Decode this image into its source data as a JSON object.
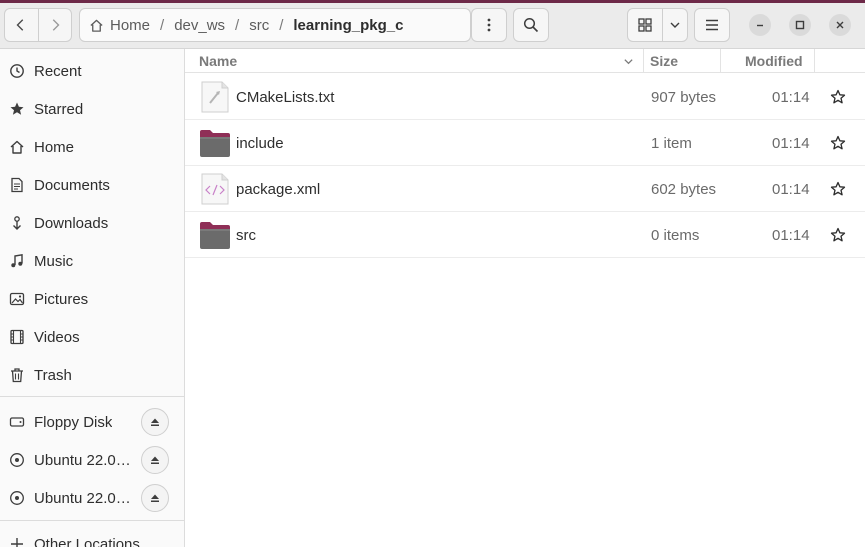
{
  "window": {
    "accent_color": "#6d2948"
  },
  "toolbar": {
    "back_icon": "chevron-left-icon",
    "forward_icon": "chevron-right-icon",
    "breadcrumb": {
      "home_icon": "home-icon",
      "segments": [
        "Home",
        "dev_ws",
        "src",
        "learning_pkg_c"
      ],
      "separator": "/"
    },
    "path_menu_icon": "vertical-dots-icon",
    "search_icon": "search-icon",
    "view_icon": "grid-view-icon",
    "view_options_icon": "chevron-down-icon",
    "main_menu_icon": "hamburger-icon",
    "window_controls": [
      "minimize-icon",
      "maximize-icon",
      "close-icon"
    ]
  },
  "sidebar": {
    "places": [
      {
        "label": "Recent",
        "icon": "clock-icon"
      },
      {
        "label": "Starred",
        "icon": "star-icon"
      },
      {
        "label": "Home",
        "icon": "home-icon"
      },
      {
        "label": "Documents",
        "icon": "document-icon"
      },
      {
        "label": "Downloads",
        "icon": "download-icon"
      },
      {
        "label": "Music",
        "icon": "music-icon"
      },
      {
        "label": "Pictures",
        "icon": "picture-icon"
      },
      {
        "label": "Videos",
        "icon": "video-icon"
      },
      {
        "label": "Trash",
        "icon": "trash-icon"
      }
    ],
    "devices": [
      {
        "label": "Floppy Disk",
        "icon": "drive-icon"
      },
      {
        "label": "Ubuntu 22.0…",
        "icon": "disc-icon"
      },
      {
        "label": "Ubuntu 22.0…",
        "icon": "disc-icon"
      }
    ],
    "other": {
      "label": "Other Locations",
      "icon": "plus-icon"
    }
  },
  "file_list": {
    "columns": {
      "name": "Name",
      "size": "Size",
      "modified": "Modified"
    },
    "rows": [
      {
        "name": "CMakeLists.txt",
        "size": "907 bytes",
        "modified": "01:14",
        "icon": "text-file-icon"
      },
      {
        "name": "include",
        "size": "1 item",
        "modified": "01:14",
        "icon": "folder-icon"
      },
      {
        "name": "package.xml",
        "size": "602 bytes",
        "modified": "01:14",
        "icon": "xml-file-icon"
      },
      {
        "name": "src",
        "size": "0 items",
        "modified": "01:14",
        "icon": "folder-icon"
      }
    ]
  }
}
